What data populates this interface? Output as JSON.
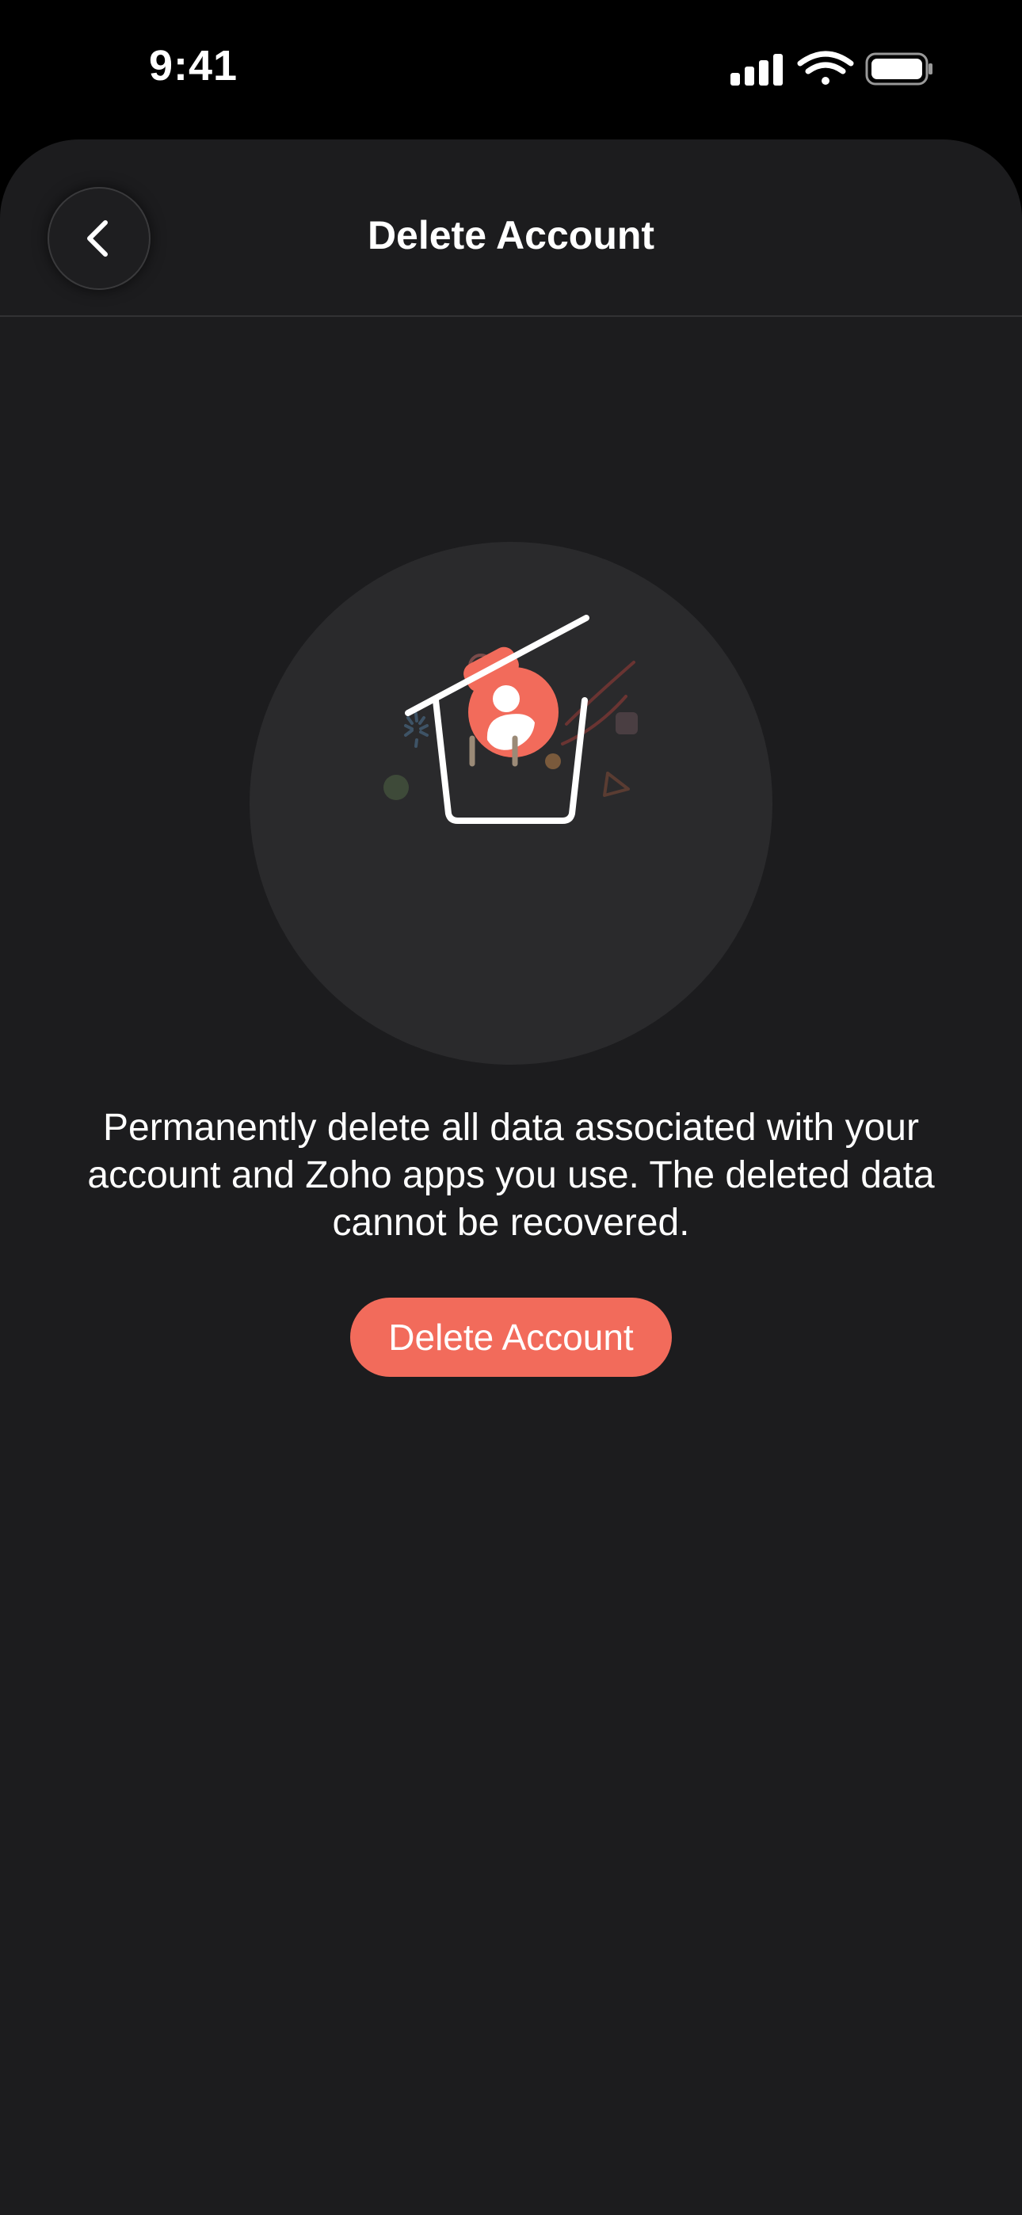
{
  "status_bar": {
    "time": "9:41",
    "icons": [
      "cellular-signal-icon",
      "wifi-icon",
      "battery-icon"
    ]
  },
  "header": {
    "title": "Delete Account",
    "back_icon": "chevron-left-icon"
  },
  "illustration": {
    "icon": "trash-with-user-icon"
  },
  "main": {
    "description": "Permanently delete all data associated with your account and Zoho apps you use. The deleted data cannot be recovered.",
    "delete_button_label": "Delete Account"
  },
  "colors": {
    "background": "#1c1c1e",
    "status_bar": "#000000",
    "accent": "#f26b5b",
    "illustration_bg": "#2a2a2c"
  }
}
